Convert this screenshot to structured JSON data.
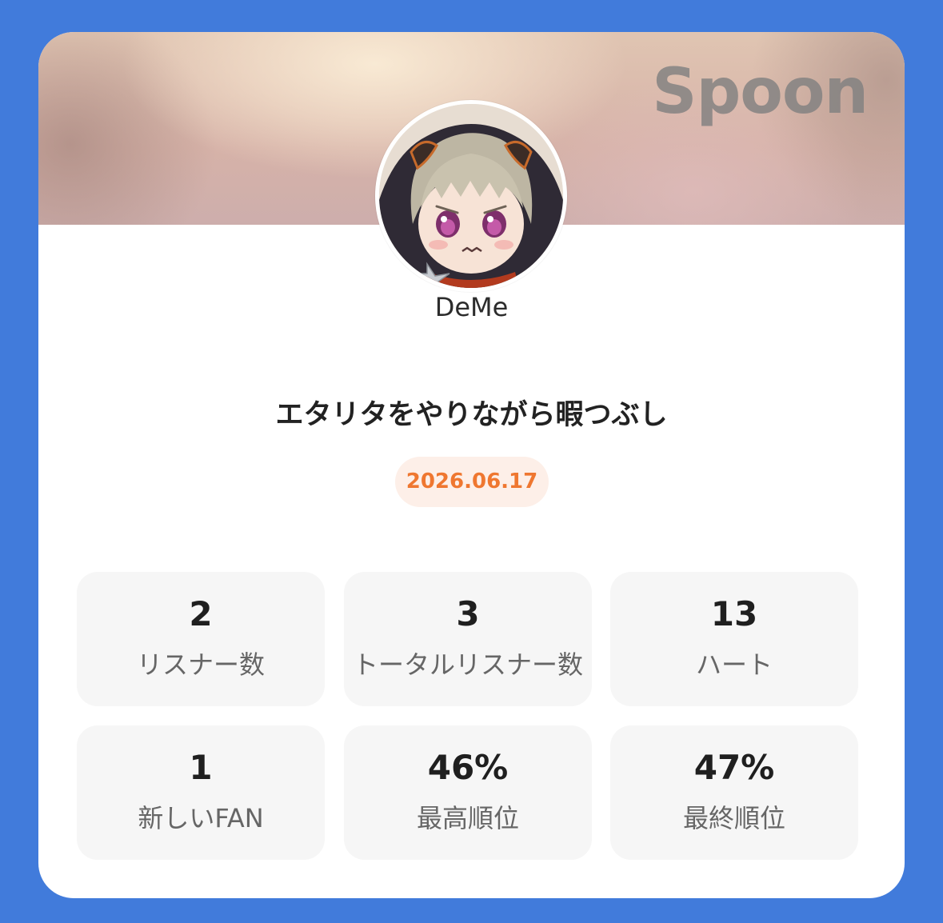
{
  "brand": {
    "logo_text": "Spoon"
  },
  "profile": {
    "username": "DeMe",
    "avatar_icon": "anime-character-avatar"
  },
  "broadcast": {
    "title": "エタリタをやりながら暇つぶし",
    "date": "2026.06.17"
  },
  "colors": {
    "background": "#417bdb",
    "accent": "#ef7730",
    "date_pill_bg": "#fdefe8",
    "stat_card_bg": "#f6f6f6"
  },
  "stats": [
    {
      "value": "2",
      "label": "リスナー数"
    },
    {
      "value": "3",
      "label": "トータルリスナー数"
    },
    {
      "value": "13",
      "label": "ハート"
    },
    {
      "value": "1",
      "label": "新しいFAN"
    },
    {
      "value": "46%",
      "label": "最高順位"
    },
    {
      "value": "47%",
      "label": "最終順位"
    }
  ]
}
